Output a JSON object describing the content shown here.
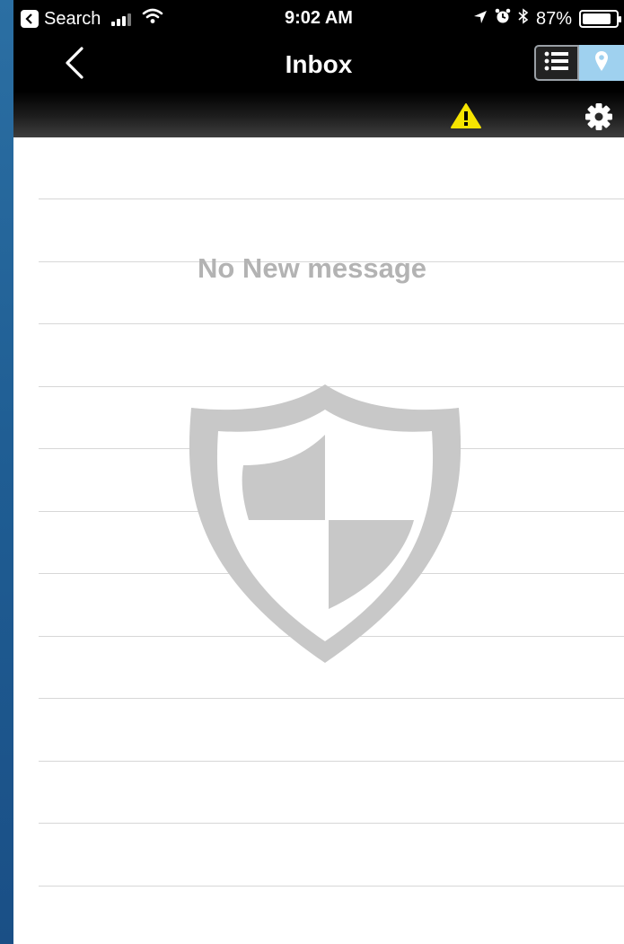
{
  "status_bar": {
    "back_app": "Search",
    "time": "9:02 AM",
    "battery": "87%",
    "battery_level": 0.87
  },
  "nav": {
    "title": "Inbox",
    "view_modes": [
      "list",
      "map"
    ],
    "selected_view": "list"
  },
  "toolbar": {
    "alert_icon": "warning-icon",
    "settings_icon": "gear-icon",
    "alert_color": "#f6e400"
  },
  "inbox": {
    "empty_text": "No New message",
    "watermark_icon": "shield-icon",
    "watermark_color": "#c8c8c8"
  }
}
